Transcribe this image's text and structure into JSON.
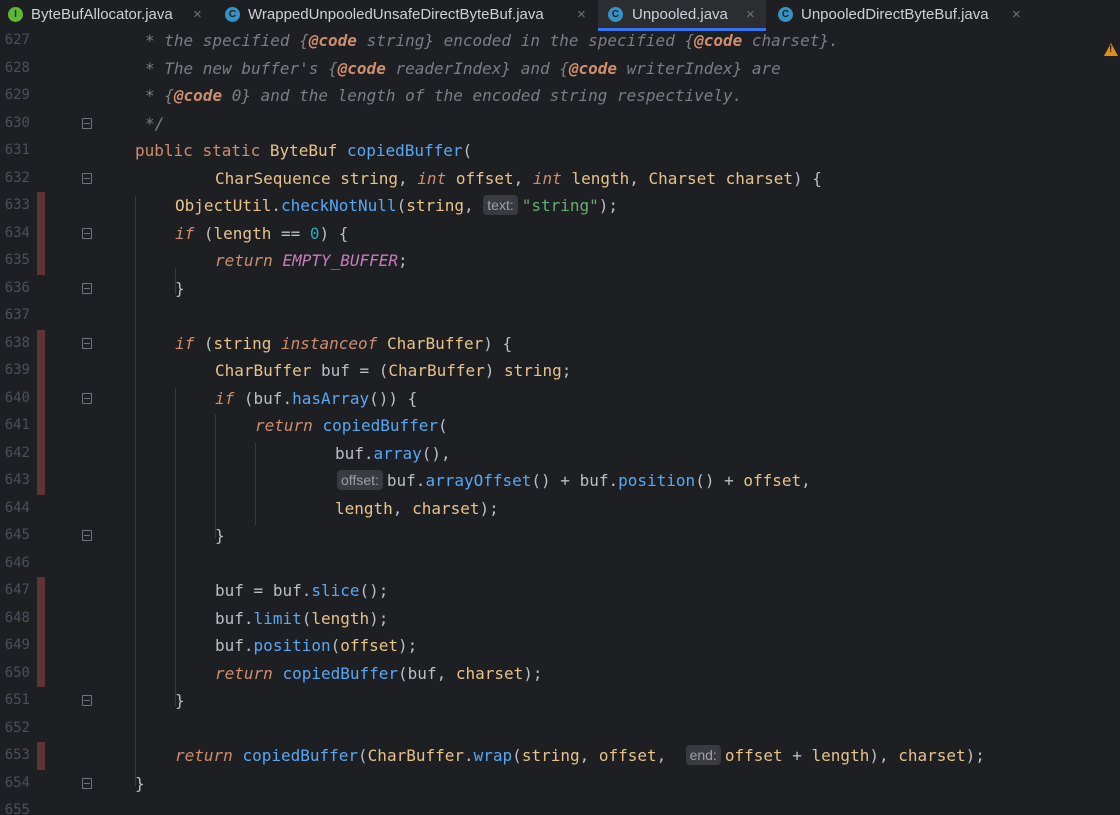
{
  "tabs": [
    {
      "name": "ByteBufAllocator.java",
      "icon": "interface-icon",
      "badge": "I",
      "active": false
    },
    {
      "name": "WrappedUnpooledUnsafeDirectByteBuf.java",
      "icon": "class-icon",
      "badge": "C",
      "active": false
    },
    {
      "name": "Unpooled.java",
      "icon": "class-icon",
      "badge": "C",
      "active": true
    },
    {
      "name": "UnpooledDirectByteBuf.java",
      "icon": "class-icon",
      "badge": "C",
      "active": false
    }
  ],
  "close_glyph": "×",
  "line_numbers": [
    "627",
    "628",
    "629",
    "630",
    "631",
    "632",
    "633",
    "634",
    "635",
    "636",
    "637",
    "638",
    "639",
    "640",
    "641",
    "642",
    "643",
    "644",
    "645",
    "646",
    "647",
    "648",
    "649",
    "650",
    "651",
    "652",
    "653",
    "654",
    "655"
  ],
  "code": {
    "l627": {
      "star": "* ",
      "t1": "the specified {",
      "tag1": "@code",
      "t2": " string} encoded in the specified {",
      "tag2": "@code",
      "t3": " charset}."
    },
    "l628": {
      "star": "* ",
      "t1": "The new buffer's {",
      "tag1": "@code",
      "t2": " readerIndex} and {",
      "tag2": "@code",
      "t3": " writerIndex} are"
    },
    "l629": {
      "star": "* ",
      "t1": "{",
      "tag1": "@code",
      "t2": " 0} and the length of the encoded string respectively."
    },
    "l630": {
      "t1": "*/"
    },
    "l631": {
      "k1": "public",
      "k2": "static",
      "type": "ByteBuf",
      "fn": "copiedBuffer",
      "rest": "("
    },
    "l632": {
      "type1": "CharSequence",
      "p1": "string",
      "k1": "int",
      "p2": "offset",
      "k2": "int",
      "p3": "length",
      "type2": "Charset",
      "p4": "charset",
      "rest": ") {"
    },
    "l633": {
      "cls": "ObjectUtil",
      "m": "checkNotNull",
      "p1": "string",
      "hint": "text:",
      "str": "\"string\"",
      "rest": ");"
    },
    "l634": {
      "k": "if",
      "p": "length",
      "op": " == ",
      "num": "0",
      "rest": ") {"
    },
    "l635": {
      "k": "return",
      "c": "EMPTY_BUFFER",
      "rest": ";"
    },
    "l636": {
      "rest": "}"
    },
    "l638": {
      "k": "if",
      "p": "string",
      "k2": "instanceof",
      "type": "CharBuffer",
      "rest": ") {"
    },
    "l639": {
      "type": "CharBuffer",
      "v": "buf",
      "type2": "CharBuffer",
      "p": "string",
      "rest": ";"
    },
    "l640": {
      "k": "if",
      "v": "buf",
      "m": "hasArray",
      "rest": "()) {"
    },
    "l641": {
      "k": "return",
      "m": "copiedBuffer",
      "rest": "("
    },
    "l642": {
      "v": "buf",
      "m": "array",
      "rest": "(),"
    },
    "l643": {
      "hint": "offset:",
      "v1": "buf",
      "m1": "arrayOffset",
      "v2": "buf",
      "m2": "position",
      "p": "offset",
      "rest": ","
    },
    "l644": {
      "p1": "length",
      "p2": "charset",
      "rest": ");"
    },
    "l645": {
      "rest": "}"
    },
    "l647": {
      "v1": "buf",
      "v2": "buf",
      "m": "slice",
      "rest": "();"
    },
    "l648": {
      "v": "buf",
      "m": "limit",
      "p": "length",
      "rest": ");"
    },
    "l649": {
      "v": "buf",
      "m": "position",
      "p": "offset",
      "rest": ");"
    },
    "l650": {
      "k": "return",
      "m": "copiedBuffer",
      "v": "buf",
      "p": "charset",
      "rest": ");"
    },
    "l651": {
      "rest": "}"
    },
    "l653": {
      "k": "return",
      "m": "copiedBuffer",
      "type": "CharBuffer",
      "m2": "wrap",
      "p1": "string",
      "p2": "offset",
      "hint": "end:",
      "p3": "offset",
      "p4": "length",
      "p5": "charset",
      "rest": ");"
    },
    "l654": {
      "rest": "}"
    }
  },
  "colors": {
    "accent": "#3574f0",
    "background": "#1e1f22",
    "warning": "#e08c1a"
  }
}
